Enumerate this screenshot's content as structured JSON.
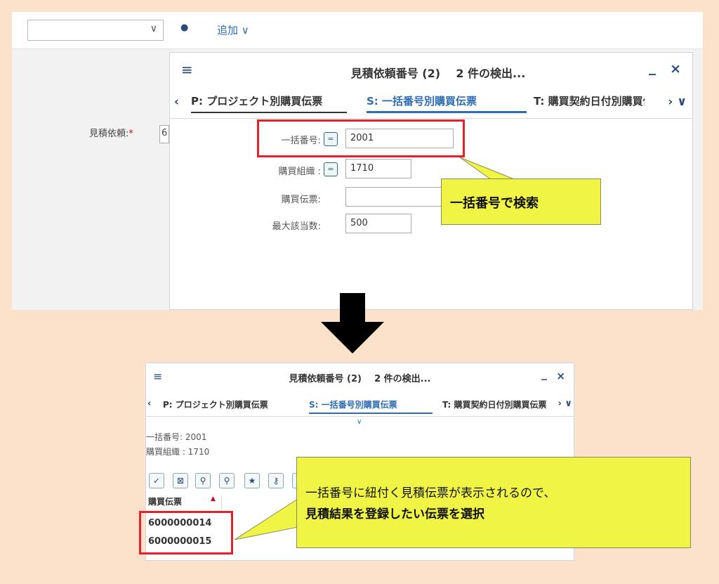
{
  "top": {
    "toolbar": {
      "dropdown_value": "",
      "dropdown_chevron": "∨",
      "hat_icon": "●",
      "add_label": "追加 ∨"
    },
    "side": {
      "label": "見積依頼:",
      "required_mark": "*",
      "value": "6"
    },
    "panel": {
      "hamburger": "≡",
      "title": "見積依頼番号 (2)    2 件の検出...",
      "minimize": "_",
      "close": "×",
      "tab_prev": "‹",
      "tab_next": "› ∨",
      "tabs": [
        {
          "label": "P: プロジェクト別購買伝票"
        },
        {
          "label": "S: 一括番号別購買伝票"
        },
        {
          "label": "T: 購買契約日付別購買伝票"
        }
      ],
      "form": [
        {
          "label": "一括番号:",
          "icon": "=",
          "value": "2001"
        },
        {
          "label": "購買組織 :",
          "icon": "=",
          "value": "1710"
        },
        {
          "label": "購買伝票:",
          "value": ""
        },
        {
          "label": "最大該当数:",
          "value": "500"
        }
      ]
    },
    "callout": "一括番号で検索"
  },
  "bottom": {
    "hamburger": "≡",
    "title": "見積依頼番号 (2)    2 件の検出...",
    "minimize": "_",
    "close": "×",
    "tab_prev": "‹",
    "tab_next": "› ∨",
    "tabs": [
      {
        "label": "P: プロジェクト別購買伝票"
      },
      {
        "label": "S: 一括番号別購買伝票"
      },
      {
        "label": "T: 購買契約日付別購買伝票"
      }
    ],
    "collapse": "∨",
    "criteria": [
      "一括番号: 2001",
      "購買組織 : 1710"
    ],
    "tools": [
      "✓",
      "⊠",
      "⚲",
      "⚲",
      "★",
      "⚷",
      "⎙"
    ],
    "column_header": "購買伝票",
    "sort_icon": "▲",
    "rows": [
      "6000000014",
      "6000000015"
    ],
    "callout_line1": "一括番号に紐付く見積伝票が表示されるので、",
    "callout_line2": "見積結果を登録したい伝票を選択"
  }
}
